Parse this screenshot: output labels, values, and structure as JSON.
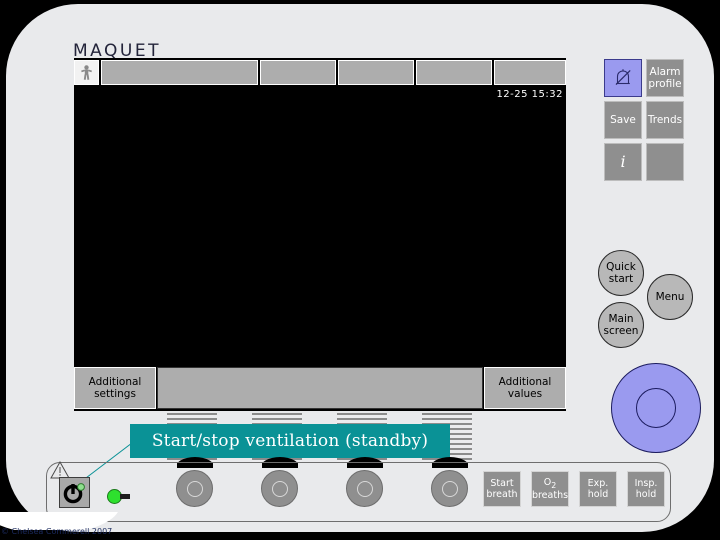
{
  "device": {
    "brand": "MAQUET",
    "patient_icon": "patient-figure-icon"
  },
  "screen": {
    "timestamp": "12-25 15:32",
    "tabs": [
      "",
      "",
      "",
      "",
      ""
    ],
    "bottom_left_button": {
      "line1": "Additional",
      "line2": "settings"
    },
    "bottom_right_button": {
      "line1": "Additional",
      "line2": "values"
    }
  },
  "side_buttons": {
    "alarm_silence": {
      "icon": "bell-slash-icon",
      "label": ""
    },
    "alarm_profile": {
      "line1": "Alarm",
      "line2": "profile"
    },
    "save": {
      "label": "Save"
    },
    "trends": {
      "label": "Trends"
    },
    "info": {
      "label": "i"
    },
    "blank": {
      "label": ""
    }
  },
  "round_buttons": {
    "quick_start": {
      "line1": "Quick",
      "line2": "start"
    },
    "menu": {
      "label": "Menu"
    },
    "main_screen": {
      "line1": "Main",
      "line2": "screen"
    }
  },
  "bottom_buttons": {
    "start_breath": {
      "line1": "Start",
      "line2": "breath"
    },
    "o2_breaths": {
      "line1": "O",
      "sub": "2",
      "line2": "breaths"
    },
    "exp_hold": {
      "line1": "Exp.",
      "line2": "hold"
    },
    "insp_hold": {
      "line1": "Insp.",
      "line2": "hold"
    }
  },
  "callout": {
    "text": "Start/stop ventilation (standby)",
    "color": "#0a9296"
  },
  "colors": {
    "shell": "#e9eaec",
    "screen_bg": "#000000",
    "button_gray": "#8f8f8f",
    "tab_gray": "#adadad",
    "knob_purple": "#9a9aef",
    "led_green": "#2ee02e",
    "callout_teal": "#0a9296"
  },
  "watermark": {
    "text": "© Chelsea Commerell 2007"
  }
}
